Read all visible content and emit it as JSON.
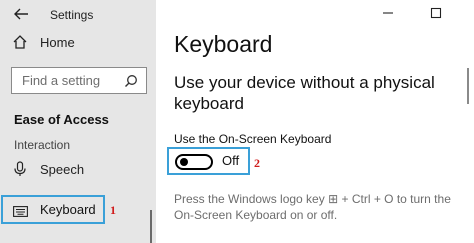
{
  "sidebar": {
    "back_icon": "back-arrow-icon",
    "app_title": "Settings",
    "home_label": "Home",
    "home_icon": "home-icon",
    "search_placeholder": "Find a setting",
    "search_icon": "search-icon",
    "section_title": "Ease of Access",
    "group_label": "Interaction",
    "items": [
      {
        "label": "Speech",
        "icon": "microphone-icon",
        "selected": false
      },
      {
        "label": "Keyboard",
        "icon": "keyboard-icon",
        "selected": true
      }
    ]
  },
  "window_controls": {
    "minimize_icon": "minimize-icon",
    "maximize_icon": "maximize-icon"
  },
  "main": {
    "page_title": "Keyboard",
    "heading": "Use your device without a physical keyboard",
    "toggle": {
      "label": "Use the On-Screen Keyboard",
      "state_text": "Off",
      "on": false
    },
    "description": {
      "before_key": "Press the Windows logo key",
      "key_glyph": "⊞",
      "after_key": "+ Ctrl + O to turn the On-Screen Keyboard on or off."
    }
  },
  "annotations": {
    "marker_1": "1",
    "marker_2": "2"
  },
  "colors": {
    "sidebar_bg": "#e6e6e6",
    "highlight_box": "#3aa0d8",
    "marker": "#d01c1c",
    "description_text": "#6d6d6d"
  }
}
